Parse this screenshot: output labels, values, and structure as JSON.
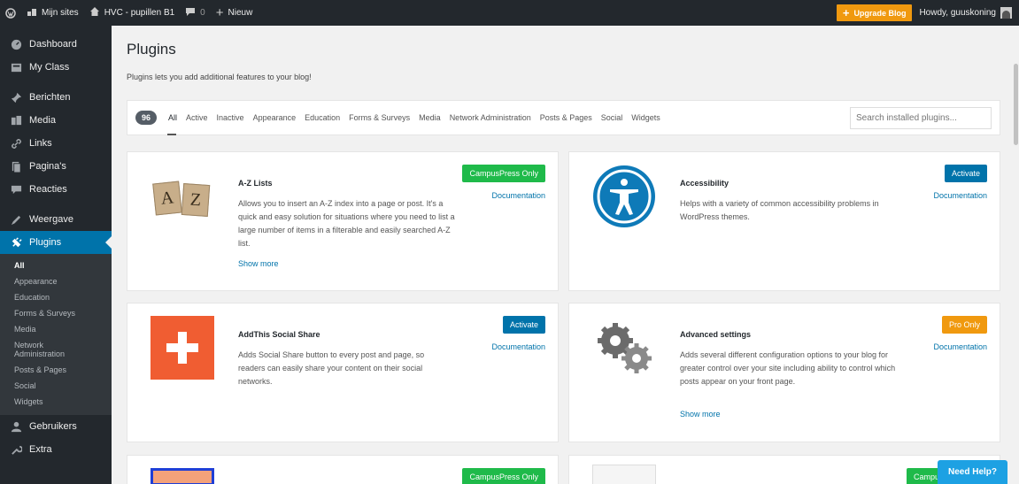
{
  "adminbar": {
    "my_sites": "Mijn sites",
    "site_name": "HVC - pupillen B1",
    "comments_count": "0",
    "new_label": "Nieuw",
    "upgrade_label": "Upgrade Blog",
    "howdy": "Howdy, guuskoning"
  },
  "sidebar": {
    "items_top": [
      {
        "label": "Dashboard",
        "icon": "dashboard-icon"
      },
      {
        "label": "My Class",
        "icon": "class-icon"
      },
      {
        "label": "Berichten",
        "icon": "pin-icon"
      },
      {
        "label": "Media",
        "icon": "media-icon"
      },
      {
        "label": "Links",
        "icon": "links-icon"
      },
      {
        "label": "Pagina's",
        "icon": "pages-icon"
      },
      {
        "label": "Reacties",
        "icon": "comments-icon"
      },
      {
        "label": "Weergave",
        "icon": "appearance-icon"
      },
      {
        "label": "Plugins",
        "icon": "plugins-icon"
      }
    ],
    "submenu": [
      "All",
      "Appearance",
      "Education",
      "Forms & Surveys",
      "Media",
      "Network Administration",
      "Posts & Pages",
      "Social",
      "Widgets"
    ],
    "items_bottom": [
      {
        "label": "Gebruikers",
        "icon": "users-icon"
      },
      {
        "label": "Extra",
        "icon": "tools-icon"
      }
    ]
  },
  "page": {
    "title": "Plugins",
    "description": "Plugins lets you add additional features to your blog!"
  },
  "filter": {
    "count": "96",
    "links": [
      "All",
      "Active",
      "Inactive",
      "Appearance",
      "Education",
      "Forms & Surveys",
      "Media",
      "Network Administration",
      "Posts & Pages",
      "Social",
      "Widgets"
    ],
    "search_placeholder": "Search installed plugins..."
  },
  "plugins": [
    {
      "name": "A-Z Lists",
      "description": "Allows you to insert an A-Z index into a page or post. It's a quick and easy solution for situations where you need to list a large number of items in a filterable and easily searched A-Z list.",
      "show_more": "Show more",
      "button": "CampusPress Only",
      "documentation": "Documentation",
      "icon_letters": [
        "A",
        "Z"
      ]
    },
    {
      "name": "Accessibility",
      "description": "Helps with a variety of common accessibility problems in WordPress themes.",
      "button": "Activate",
      "documentation": "Documentation"
    },
    {
      "name": "AddThis Social Share",
      "description": "Adds Social Share button to every post and page, so readers can easily share your content on their social networks.",
      "button": "Activate",
      "documentation": "Documentation"
    },
    {
      "name": "Advanced settings",
      "description": "Adds several different configuration options to your blog for greater control over your site including ability to control which posts appear on your front page.",
      "show_more": "Show more",
      "button": "Pro Only",
      "documentation": "Documentation"
    },
    {
      "button": "CampusPress Only"
    },
    {
      "button": "Campu"
    }
  ],
  "help": {
    "label": "Need Help?"
  },
  "colors": {
    "admin_dark": "#23282d",
    "accent_blue": "#0073aa",
    "campus_green": "#1fba4a",
    "pro_orange": "#f0990f",
    "addthis_red": "#f05d32"
  }
}
